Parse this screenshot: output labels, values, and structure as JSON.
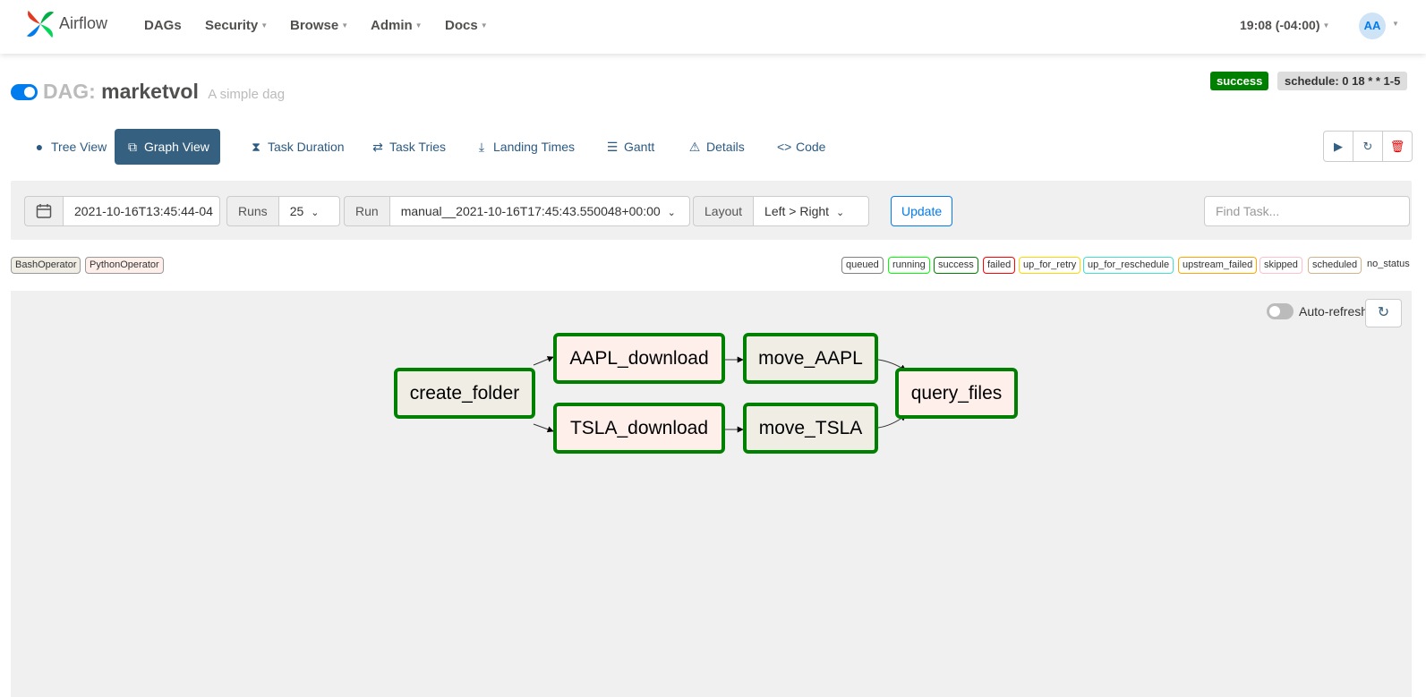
{
  "app": {
    "name": "Airflow"
  },
  "nav": {
    "items": [
      {
        "label": "DAGs",
        "has_menu": false
      },
      {
        "label": "Security",
        "has_menu": true
      },
      {
        "label": "Browse",
        "has_menu": true
      },
      {
        "label": "Admin",
        "has_menu": true
      },
      {
        "label": "Docs",
        "has_menu": true
      }
    ],
    "clock": "19:08 (-04:00)",
    "user_initials": "AA"
  },
  "dag": {
    "prefix": "DAG:",
    "id": "marketvol",
    "description": "A simple dag",
    "status": "success",
    "schedule": "schedule: 0 18 * * 1-5",
    "paused": false
  },
  "tabs": [
    {
      "label": "Tree View",
      "icon": "tree-icon",
      "glyph": "●"
    },
    {
      "label": "Graph View",
      "icon": "graph-icon",
      "glyph": "⧉",
      "active": true
    },
    {
      "label": "Task Duration",
      "icon": "hourglass-icon",
      "glyph": "⧗"
    },
    {
      "label": "Task Tries",
      "icon": "retry-icon",
      "glyph": "⇄"
    },
    {
      "label": "Landing Times",
      "icon": "plane-landing-icon",
      "glyph": "⤓"
    },
    {
      "label": "Gantt",
      "icon": "gantt-icon",
      "glyph": "☰"
    },
    {
      "label": "Details",
      "icon": "warning-triangle-icon",
      "glyph": "⚠"
    },
    {
      "label": "Code",
      "icon": "code-icon",
      "glyph": "<>"
    }
  ],
  "actions": {
    "trigger": "play-icon",
    "refresh": "refresh-icon",
    "delete": "trash-icon"
  },
  "controls": {
    "base_date": "2021-10-16T13:45:44-04",
    "runs_label": "Runs",
    "runs_value": "25",
    "run_label": "Run",
    "run_value": "manual__2021-10-16T17:45:43.550048+00:00",
    "layout_label": "Layout",
    "layout_value": "Left > Right",
    "update_label": "Update",
    "find_placeholder": "Find Task..."
  },
  "operators": [
    {
      "label": "BashOperator",
      "color": "#f0ede4"
    },
    {
      "label": "PythonOperator",
      "color": "#ffefeb"
    }
  ],
  "states": [
    {
      "label": "queued",
      "color": "#808080"
    },
    {
      "label": "running",
      "color": "#00ff00"
    },
    {
      "label": "success",
      "color": "#008000"
    },
    {
      "label": "failed",
      "color": "#ff0000"
    },
    {
      "label": "up_for_retry",
      "color": "#ffd700"
    },
    {
      "label": "up_for_reschedule",
      "color": "#40e0d0"
    },
    {
      "label": "upstream_failed",
      "color": "#ffa500"
    },
    {
      "label": "skipped",
      "color": "#ffc0cb"
    },
    {
      "label": "scheduled",
      "color": "#d2b48c"
    },
    {
      "label": "no_status",
      "color": ""
    }
  ],
  "graph": {
    "auto_refresh_label": "Auto-refresh",
    "auto_refresh": false,
    "nodes": [
      {
        "id": "create_folder",
        "operator": "BashOperator",
        "state": "success"
      },
      {
        "id": "AAPL_download",
        "operator": "PythonOperator",
        "state": "success"
      },
      {
        "id": "TSLA_download",
        "operator": "PythonOperator",
        "state": "success"
      },
      {
        "id": "move_AAPL",
        "operator": "BashOperator",
        "state": "success"
      },
      {
        "id": "move_TSLA",
        "operator": "BashOperator",
        "state": "success"
      },
      {
        "id": "query_files",
        "operator": "PythonOperator",
        "state": "success"
      }
    ]
  }
}
